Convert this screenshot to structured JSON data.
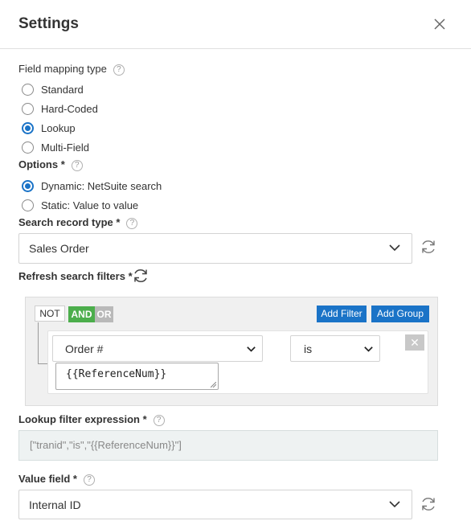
{
  "header": {
    "title": "Settings"
  },
  "field_mapping_type": {
    "label": "Field mapping type",
    "help": "?",
    "options": [
      "Standard",
      "Hard-Coded",
      "Lookup",
      "Multi-Field"
    ],
    "selected": "Lookup"
  },
  "options_group": {
    "label": "Options *",
    "help": "?",
    "options": [
      "Dynamic: NetSuite search",
      "Static: Value to value"
    ],
    "selected": "Dynamic: NetSuite search"
  },
  "search_record_type": {
    "label": "Search record type *",
    "help": "?",
    "value": "Sales Order"
  },
  "refresh_search_filters": {
    "label": "Refresh search filters *"
  },
  "filter_builder": {
    "not_label": "NOT",
    "and_label": "AND",
    "or_label": "OR",
    "add_filter_label": "Add Filter",
    "add_group_label": "Add Group",
    "rule": {
      "field": "Order #",
      "operator": "is",
      "value": "{{ReferenceNum}}",
      "delete_symbol": "✕"
    }
  },
  "lookup_filter_expression": {
    "label": "Lookup filter expression *",
    "help": "?",
    "value": "[\"tranid\",\"is\",\"{{ReferenceNum}}\"]"
  },
  "value_field": {
    "label": "Value field *",
    "help": "?",
    "value": "Internal ID"
  },
  "colors": {
    "accent": "#1a73c7",
    "and_active": "#4cae4c",
    "or_inactive": "#b9b9b9"
  }
}
